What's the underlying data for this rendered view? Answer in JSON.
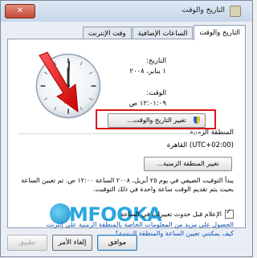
{
  "window": {
    "title": "التاريخ والوقت",
    "close_label": "✕"
  },
  "tabs": [
    {
      "label": "التاريخ والوقت"
    },
    {
      "label": "الساعات الإضافية"
    },
    {
      "label": "وقت الإنترنت"
    }
  ],
  "datetime": {
    "date_label": "التاريخ:",
    "date_value": "١ يناير، ٢٠٠٨",
    "time_label": "الوقت:",
    "time_value": "١٢:٠١:٠٩ ص",
    "change_button": "تغيير التاريخ والوقت..."
  },
  "timezone": {
    "header": "المنطقة الزمنية",
    "value": "(UTC+02:00) القاهرة",
    "change_button": "تغيير المنطقة الزمنية..."
  },
  "dst_info": "يبدأ التوقيت الصيفي في يوم ٢٥ أبريل، ٢٠٠٨ الساعة ١٢:٠٠ ص. تم تعيين الساعة بحيث يتم تقديم الوقت ساعة واحدة في ذلك التوقيت.",
  "notify_label": "الإعلام قبل حدوث تغييرات في الساعة",
  "links": {
    "online_info": "الحصول على مزيد من المعلومات الخاصة بالمنطقة الزمنية على إنترنت",
    "how_to": "كيف يمكنني تعيين الساعة والمنطقة الزمنية؟"
  },
  "watermark": {
    "text": "MFOOKA"
  },
  "buttons": {
    "ok": "موافق",
    "cancel": "إلغاء الأمر",
    "apply": "تطبيق"
  },
  "colors": {
    "highlight": "#e01818",
    "link": "#0a4fb5",
    "watermark": "#2aa6df"
  }
}
